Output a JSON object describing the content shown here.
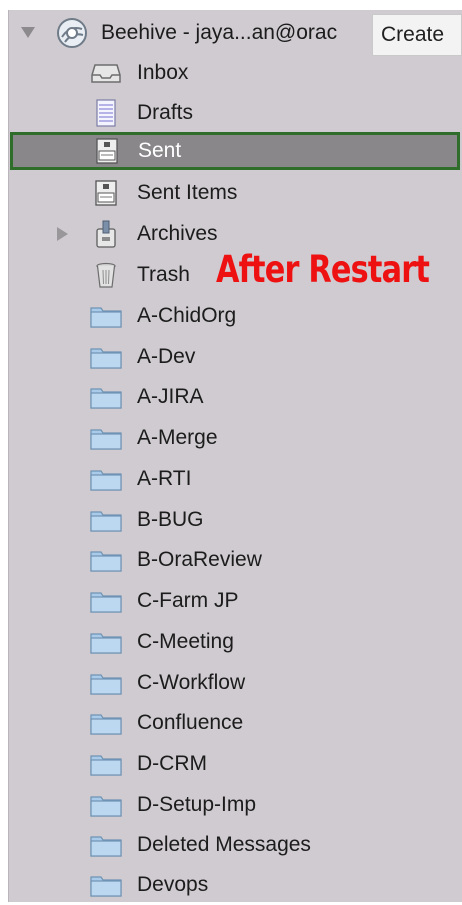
{
  "account": {
    "label": "Beehive - jaya...an@orac",
    "icon": "globe-account-icon"
  },
  "tooltip": {
    "text": "Create"
  },
  "annotation": {
    "text": "After Restart",
    "color": "#ee1111"
  },
  "selection": {
    "highlight": "#8a878b",
    "border": "#2e6e2a"
  },
  "folders": [
    {
      "label": "Inbox",
      "icon": "inbox-icon"
    },
    {
      "label": "Drafts",
      "icon": "drafts-icon"
    },
    {
      "label": "Sent",
      "icon": "sent-icon",
      "selected": true
    },
    {
      "label": "Sent Items",
      "icon": "sent-icon"
    },
    {
      "label": "Archives",
      "icon": "archive-icon",
      "expandable": true
    },
    {
      "label": "Trash",
      "icon": "trash-icon"
    },
    {
      "label": "A-ChidOrg",
      "icon": "folder-icon"
    },
    {
      "label": "A-Dev",
      "icon": "folder-icon"
    },
    {
      "label": "A-JIRA",
      "icon": "folder-icon"
    },
    {
      "label": "A-Merge",
      "icon": "folder-icon"
    },
    {
      "label": "A-RTI",
      "icon": "folder-icon"
    },
    {
      "label": "B-BUG",
      "icon": "folder-icon"
    },
    {
      "label": "B-OraReview",
      "icon": "folder-icon"
    },
    {
      "label": "C-Farm JP",
      "icon": "folder-icon"
    },
    {
      "label": "C-Meeting",
      "icon": "folder-icon"
    },
    {
      "label": "C-Workflow",
      "icon": "folder-icon"
    },
    {
      "label": "Confluence",
      "icon": "folder-icon"
    },
    {
      "label": "D-CRM",
      "icon": "folder-icon"
    },
    {
      "label": "D-Setup-Imp",
      "icon": "folder-icon"
    },
    {
      "label": "Deleted Messages",
      "icon": "folder-icon"
    },
    {
      "label": "Devops",
      "icon": "folder-icon"
    }
  ]
}
